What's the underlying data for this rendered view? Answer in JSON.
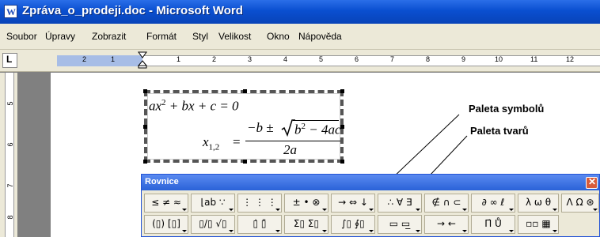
{
  "window": {
    "title": "Zpráva_o_prodeji.doc - Microsoft Word"
  },
  "menu": [
    "Soubor",
    "Úpravy",
    "Zobrazit",
    "Formát",
    "Styl",
    "Velikost",
    "Okno",
    "Nápověda"
  ],
  "ruler": {
    "tab_symbol": "L",
    "neg_numbers": [
      "2",
      "1"
    ],
    "numbers": [
      "1",
      "2",
      "3",
      "4",
      "5",
      "6",
      "7",
      "8",
      "9",
      "10",
      "11",
      "12"
    ]
  },
  "vertical_ruler": {
    "numbers": [
      "5",
      "6",
      "7",
      "8"
    ]
  },
  "equation": {
    "line1_lhs": "ax",
    "line1_exp": "2",
    "line1_rest": " + bx + c = 0",
    "x_var": "x",
    "x_sub": "1,2",
    "equals": "=",
    "numerator_pre": "−b ±",
    "radicand_b": "b",
    "radicand_exp": "2",
    "radicand_rest": " − 4ac",
    "denominator": "2a"
  },
  "callouts": {
    "symbols": "Paleta symbolů",
    "shapes": "Paleta tvarů"
  },
  "toolbar": {
    "title": "Rovnice",
    "close_symbol": "✕",
    "row1": [
      "≤ ≠ ≈",
      "⌊ab ∵",
      "⋮ ⋮ ⋮",
      "± • ⊗",
      "→ ⇔ ↓",
      "∴ ∀ ∃",
      "∉ ∩ ⊂",
      "∂ ∞ ℓ",
      "λ ω θ",
      "Λ Ω ⊛"
    ],
    "row2": [
      "(▯) [▯]",
      "▯/▯ √▯",
      "▯̇ ▯̄",
      "Σ▯ Σ▯",
      "∫▯ ∮▯",
      "▭ ▭̲",
      "→ ←",
      "Π̇ Ů",
      "▫▫ ▦"
    ]
  },
  "colors": {
    "titlebar": "#0a4fd0",
    "toolbar_bg": "#ece9d8",
    "ruler_margin": "#a7bde6"
  }
}
